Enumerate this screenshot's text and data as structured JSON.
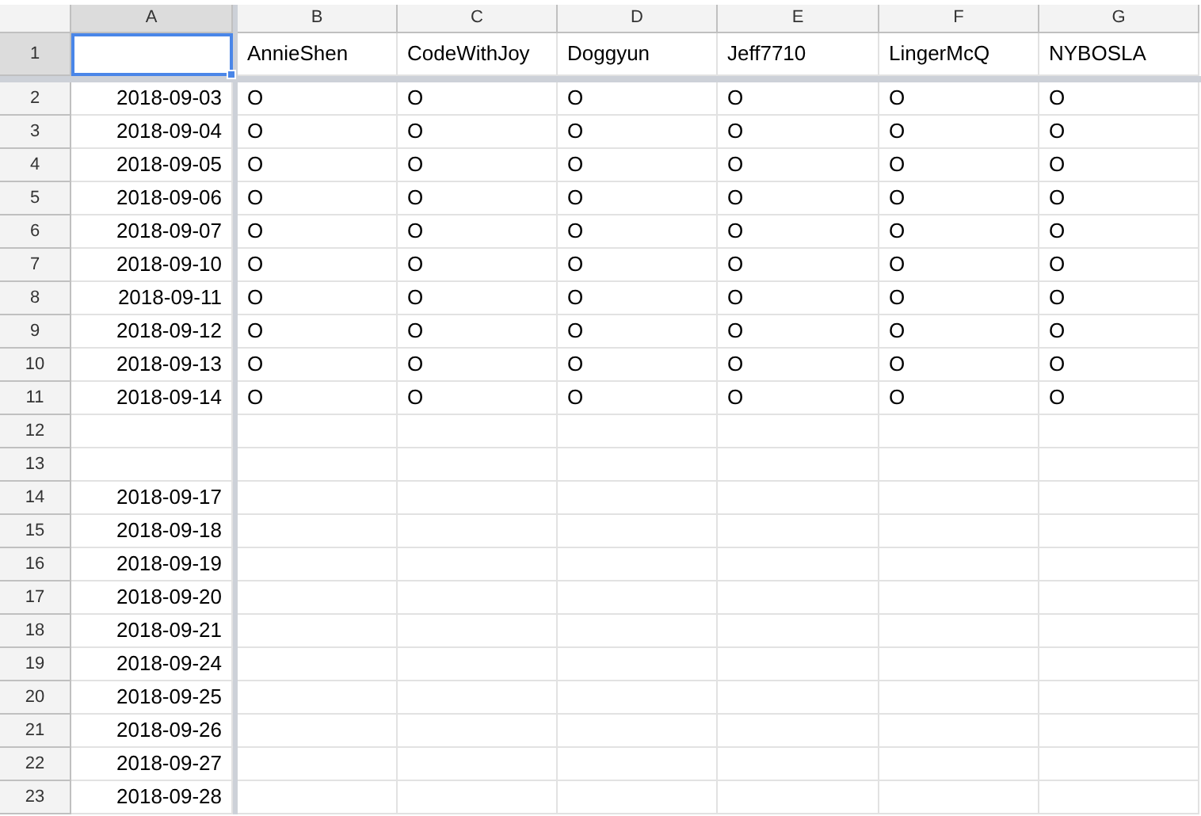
{
  "columns": [
    {
      "label": "A",
      "selected": true
    },
    {
      "label": "B",
      "selected": false
    },
    {
      "label": "C",
      "selected": false
    },
    {
      "label": "D",
      "selected": false
    },
    {
      "label": "E",
      "selected": false
    },
    {
      "label": "F",
      "selected": false
    },
    {
      "label": "G",
      "selected": false
    }
  ],
  "name_row": {
    "label": "1",
    "selected": true,
    "first_cell_selected": true,
    "names": [
      "AnnieShen",
      "CodeWithJoy",
      "Doggyun",
      "Jeff7710",
      "LingerMcQ",
      "NYBOSLA"
    ]
  },
  "rows": [
    {
      "label": "2",
      "selected": false,
      "date": "2018-09-03",
      "marks": [
        "O",
        "O",
        "O",
        "O",
        "O",
        "O"
      ]
    },
    {
      "label": "3",
      "selected": false,
      "date": "2018-09-04",
      "marks": [
        "O",
        "O",
        "O",
        "O",
        "O",
        "O"
      ]
    },
    {
      "label": "4",
      "selected": false,
      "date": "2018-09-05",
      "marks": [
        "O",
        "O",
        "O",
        "O",
        "O",
        "O"
      ]
    },
    {
      "label": "5",
      "selected": false,
      "date": "2018-09-06",
      "marks": [
        "O",
        "O",
        "O",
        "O",
        "O",
        "O"
      ]
    },
    {
      "label": "6",
      "selected": false,
      "date": "2018-09-07",
      "marks": [
        "O",
        "O",
        "O",
        "O",
        "O",
        "O"
      ]
    },
    {
      "label": "7",
      "selected": false,
      "date": "2018-09-10",
      "marks": [
        "O",
        "O",
        "O",
        "O",
        "O",
        "O"
      ]
    },
    {
      "label": "8",
      "selected": false,
      "date": "2018-09-11",
      "marks": [
        "O",
        "O",
        "O",
        "O",
        "O",
        "O"
      ]
    },
    {
      "label": "9",
      "selected": false,
      "date": "2018-09-12",
      "marks": [
        "O",
        "O",
        "O",
        "O",
        "O",
        "O"
      ]
    },
    {
      "label": "10",
      "selected": false,
      "date": "2018-09-13",
      "marks": [
        "O",
        "O",
        "O",
        "O",
        "O",
        "O"
      ]
    },
    {
      "label": "11",
      "selected": false,
      "date": "2018-09-14",
      "marks": [
        "O",
        "O",
        "O",
        "O",
        "O",
        "O"
      ]
    },
    {
      "label": "12",
      "selected": false
    },
    {
      "label": "13",
      "selected": false
    },
    {
      "label": "14",
      "selected": false,
      "date": "2018-09-17"
    },
    {
      "label": "15",
      "selected": false,
      "date": "2018-09-18"
    },
    {
      "label": "16",
      "selected": false,
      "date": "2018-09-19"
    },
    {
      "label": "17",
      "selected": false,
      "date": "2018-09-20"
    },
    {
      "label": "18",
      "selected": false,
      "date": "2018-09-21"
    },
    {
      "label": "19",
      "selected": false,
      "date": "2018-09-24"
    },
    {
      "label": "20",
      "selected": false,
      "date": "2018-09-25"
    },
    {
      "label": "21",
      "selected": false,
      "date": "2018-09-26"
    },
    {
      "label": "22",
      "selected": false,
      "date": "2018-09-27"
    },
    {
      "label": "23",
      "selected": false,
      "date": "2018-09-28"
    }
  ]
}
